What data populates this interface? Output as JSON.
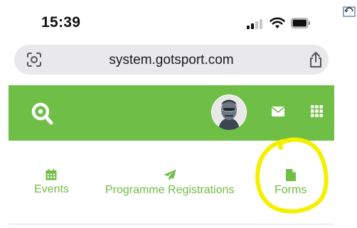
{
  "status_bar": {
    "time": "15:39"
  },
  "browser": {
    "url": "system.gotsport.com"
  },
  "top_nav": {
    "brand_color": "#6fbe45",
    "icons": [
      "logo-icon",
      "avatar",
      "mail-icon",
      "apps-grid-icon"
    ]
  },
  "sub_nav": {
    "items": [
      {
        "label": "Events",
        "icon": "calendar-icon"
      },
      {
        "label": "Programme Registrations",
        "icon": "paper-plane-icon"
      },
      {
        "label": "Forms",
        "icon": "document-icon"
      }
    ]
  },
  "annotation": {
    "color": "#f4f000",
    "shape": "hand-drawn circle around Forms"
  }
}
